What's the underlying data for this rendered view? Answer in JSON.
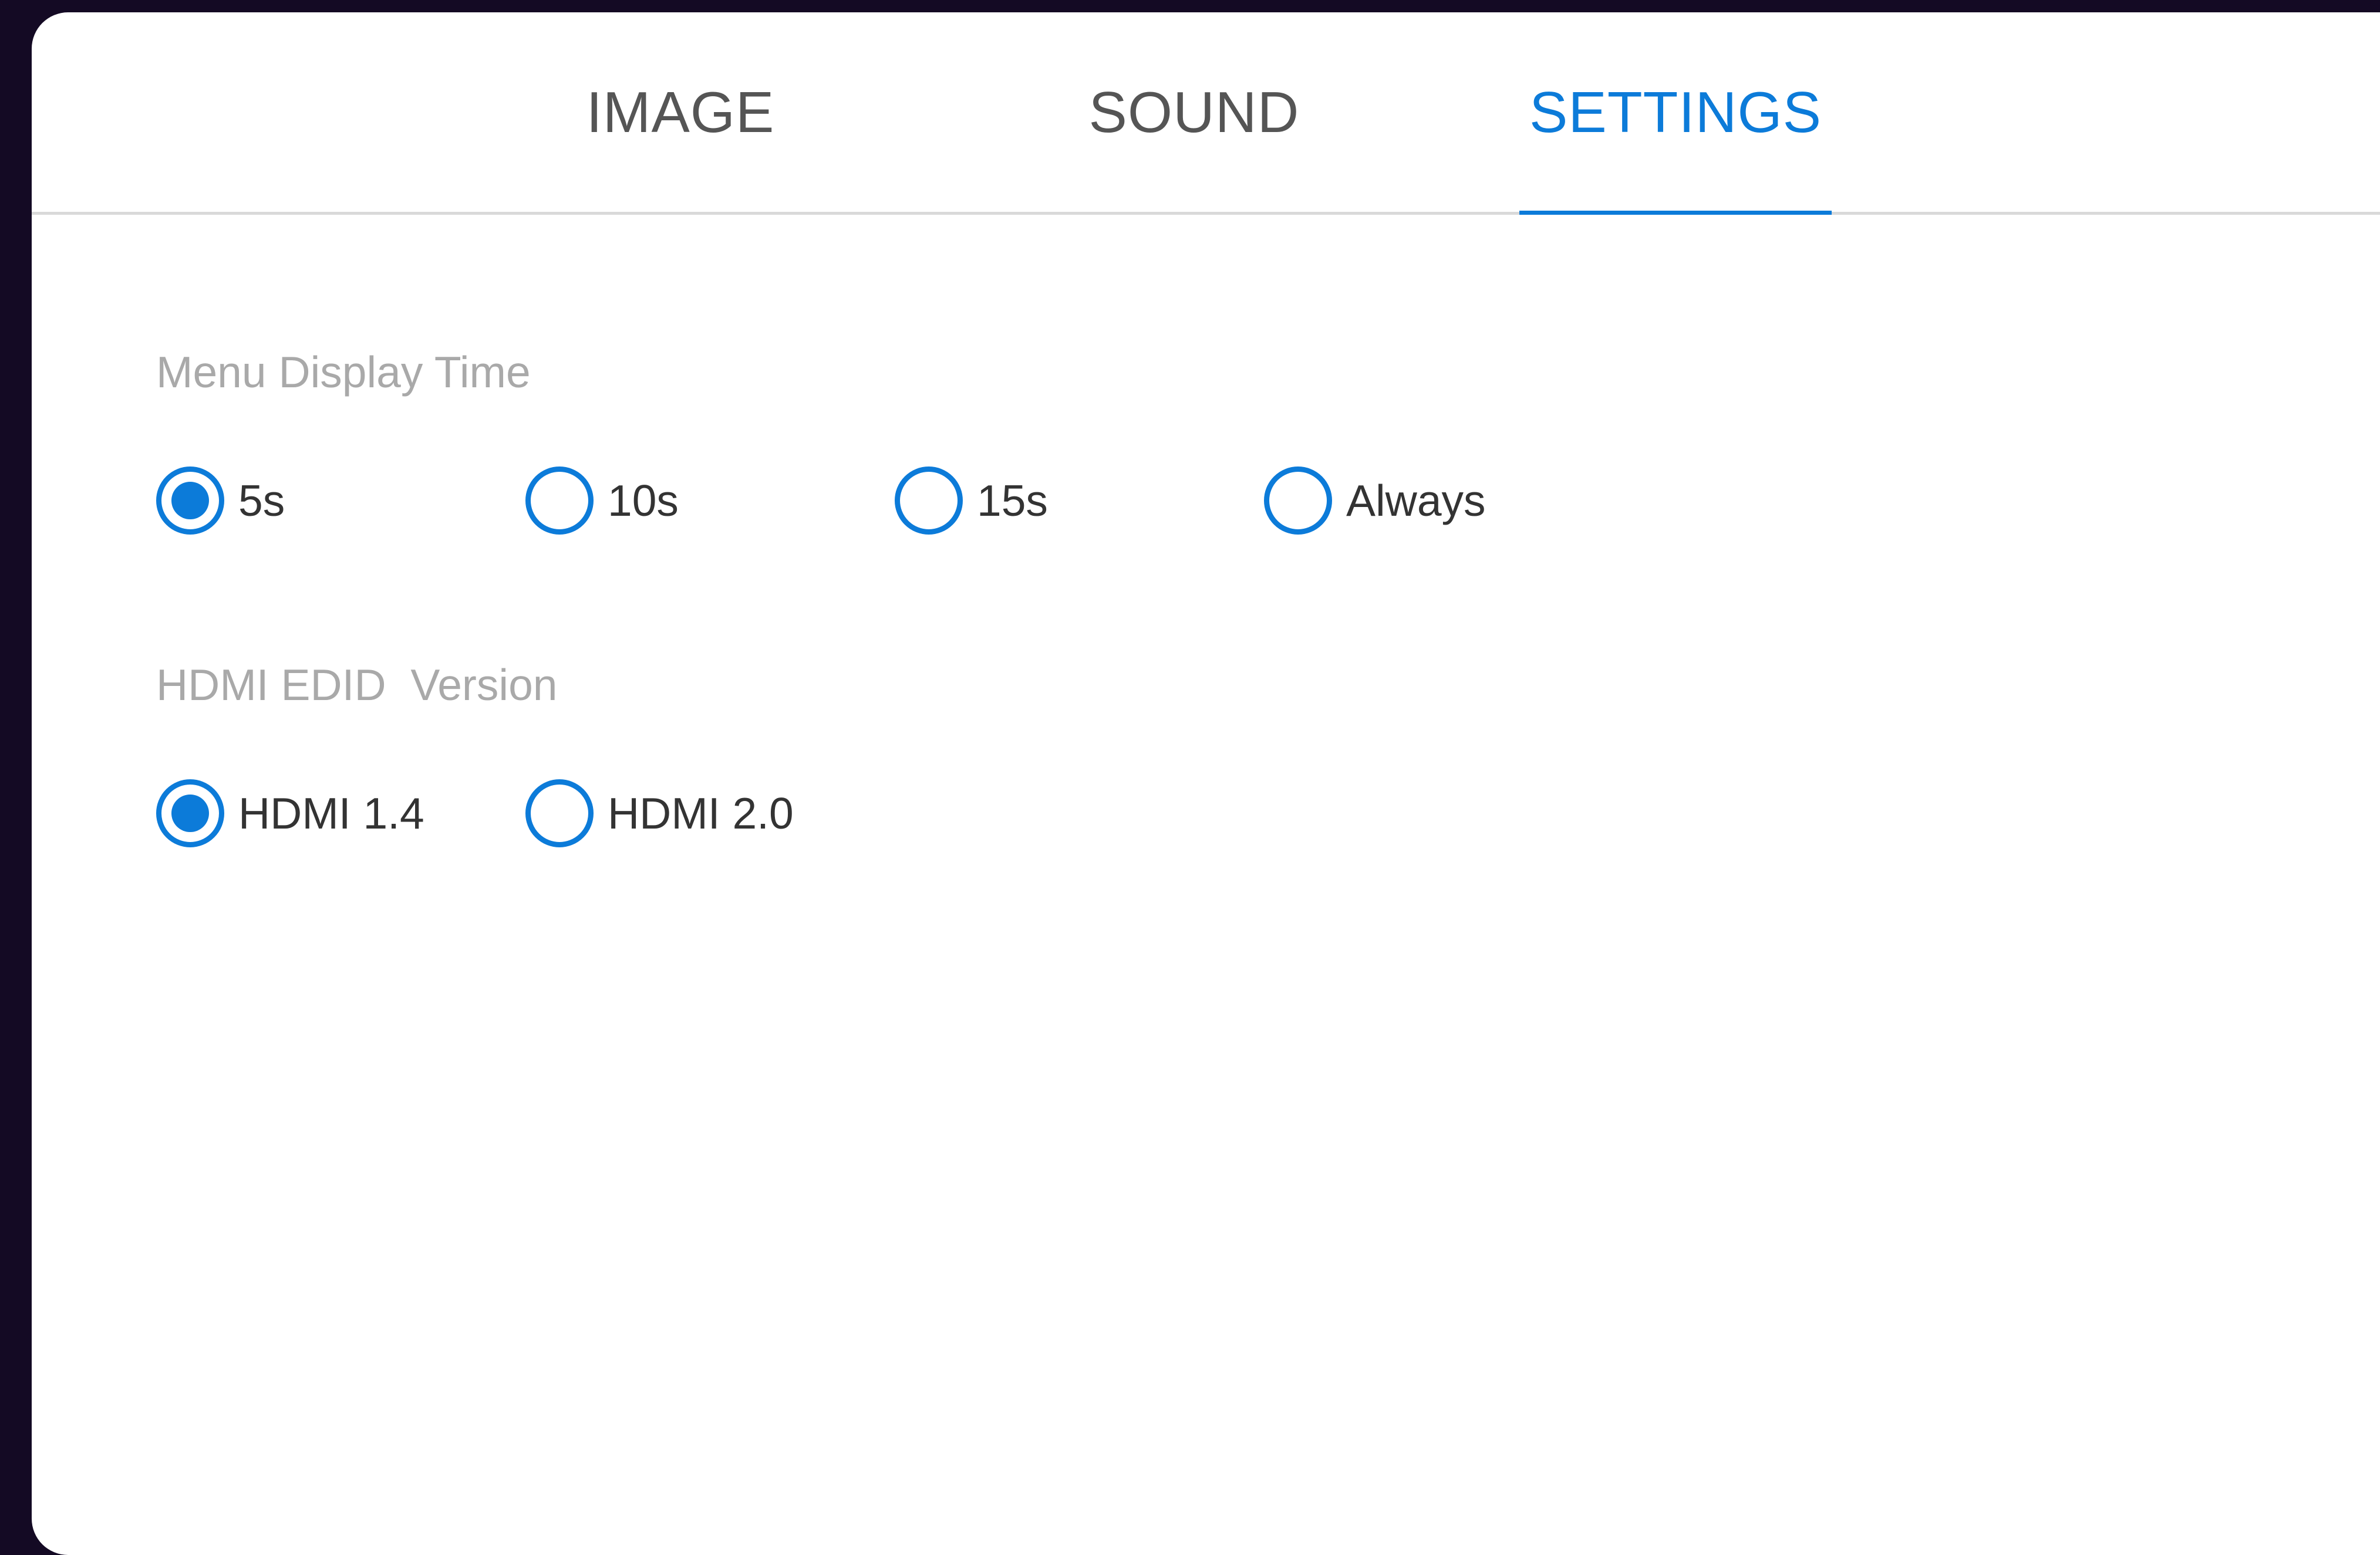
{
  "tabs": [
    {
      "label": "IMAGE",
      "active": false
    },
    {
      "label": "SOUND",
      "active": false
    },
    {
      "label": "SETTINGS",
      "active": true
    }
  ],
  "menu_display_time": {
    "label": "Menu Display Time",
    "options": [
      "5s",
      "10s",
      "15s",
      "Always"
    ],
    "selected": "5s"
  },
  "hdmi_edid": {
    "label": "HDMI EDID  Version",
    "options": [
      "HDMI 1.4",
      "HDMI 2.0"
    ],
    "selected": "HDMI 1.4"
  },
  "colors": {
    "accent": "#0c7bd9",
    "tab_inactive": "#555555",
    "section_label": "#a9a9a9",
    "background": "#140a24"
  }
}
